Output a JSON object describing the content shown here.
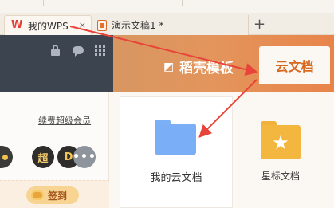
{
  "tabs": [
    {
      "label": "我的WPS",
      "close": "×"
    },
    {
      "label": "演示文稿1 *",
      "close": "×"
    }
  ],
  "new_tab": "+",
  "header": {
    "template_label": "稻壳模板",
    "cloud_tab": "云文档"
  },
  "account": {
    "renew_link": "续费超级会员",
    "badge_super": "超",
    "badge_d": "D",
    "badge_more": "•••",
    "signin": "签到"
  },
  "cloud": {
    "my_cloud": "我的云文档",
    "starred": "星标文档"
  },
  "colors": {
    "accent": "#e8844a",
    "dark_header": "#3c4450",
    "cloud_folder": "#7aaef6",
    "star_folder": "#f3b63f",
    "arrow": "#e8443a"
  }
}
